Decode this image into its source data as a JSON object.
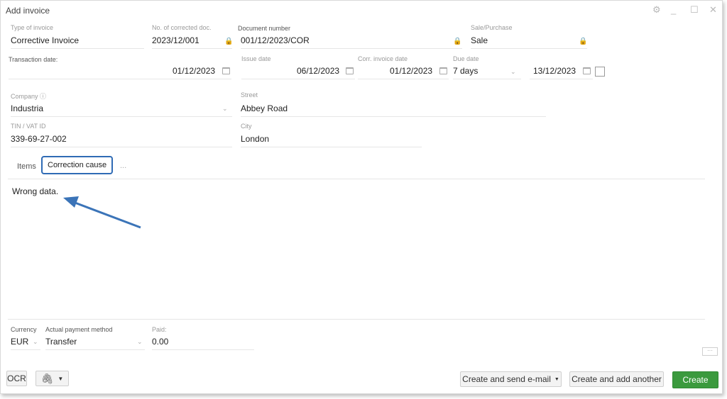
{
  "window": {
    "title": "Add invoice"
  },
  "header": {
    "type_of_invoice": {
      "label": "Type of invoice",
      "value": "Corrective Invoice"
    },
    "corrected_doc": {
      "label": "No. of corrected doc.",
      "value": "2023/12/001"
    },
    "document_number": {
      "label": "Document number",
      "value": "001/12/2023/COR"
    },
    "sale_purchase": {
      "label": "Sale/Purchase",
      "value": "Sale"
    }
  },
  "dates": {
    "transaction": {
      "label": "Transaction date:",
      "value": "01/12/2023"
    },
    "issue": {
      "label": "Issue date",
      "value": "06/12/2023"
    },
    "corr_invoice": {
      "label": "Corr. invoice date",
      "value": "01/12/2023"
    },
    "due": {
      "label": "Due date",
      "term": "7 days",
      "value": "13/12/2023"
    }
  },
  "company": {
    "company": {
      "label": "Company",
      "value": "Industria"
    },
    "street": {
      "label": "Street",
      "value": "Abbey Road"
    },
    "tin": {
      "label": "TIN / VAT ID",
      "value": "339-69-27-002"
    },
    "city": {
      "label": "City",
      "value": "London"
    }
  },
  "tabs": {
    "items": "Items",
    "correction_cause": "Correction cause",
    "more": "..."
  },
  "correction_text": "Wrong data.",
  "footer_fields": {
    "currency": {
      "label": "Currency",
      "value": "EUR"
    },
    "payment_method": {
      "label": "Actual payment method",
      "value": "Transfer"
    },
    "paid": {
      "label": "Paid:",
      "value": "0.00"
    }
  },
  "buttons": {
    "ocr": "OCR",
    "create_send": "Create and send e-mail",
    "create_another": "Create and add another",
    "create": "Create",
    "more": "···"
  },
  "colors": {
    "accent": "#2f6bb5",
    "primary": "#3b9a3e",
    "arrow": "#3b74b8"
  }
}
